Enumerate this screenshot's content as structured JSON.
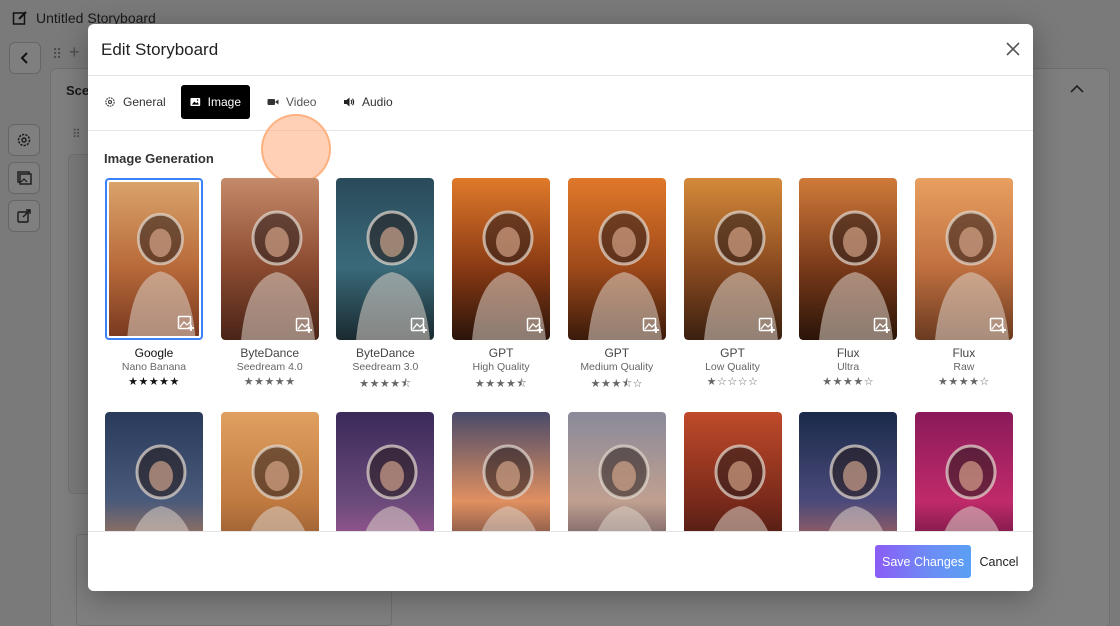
{
  "app": {
    "title": "Untitled Storyboard",
    "scene_label": "Sce"
  },
  "modal": {
    "title": "Edit Storyboard",
    "tabs": [
      {
        "label": "General",
        "icon": "gear-icon"
      },
      {
        "label": "Image",
        "icon": "image-icon",
        "active": true
      },
      {
        "label": "Video",
        "icon": "video-camera-icon"
      },
      {
        "label": "Audio",
        "icon": "speaker-icon"
      }
    ],
    "section_title": "Image Generation",
    "models": [
      {
        "name": "Google",
        "variant": "Nano Banana",
        "rating": 5,
        "selected": true
      },
      {
        "name": "ByteDance",
        "variant": "Seedream 4.0",
        "rating": 5
      },
      {
        "name": "ByteDance",
        "variant": "Seedream 3.0",
        "rating": 4.5
      },
      {
        "name": "GPT",
        "variant": "High Quality",
        "rating": 4.5
      },
      {
        "name": "GPT",
        "variant": "Medium Quality",
        "rating": 3.5
      },
      {
        "name": "GPT",
        "variant": "Low Quality",
        "rating": 1
      },
      {
        "name": "Flux",
        "variant": "Ultra",
        "rating": 4
      },
      {
        "name": "Flux",
        "variant": "Raw",
        "rating": 4
      }
    ],
    "footer": {
      "save_label": "Save Changes",
      "cancel_label": "Cancel"
    }
  },
  "colors": {
    "accent_selected": "#3b82f6",
    "save_gradient_start": "#8b5cf6",
    "save_gradient_end": "#5aa0f4",
    "tab_active_bg": "#000000",
    "highlight_ring": "#ffb07d"
  }
}
